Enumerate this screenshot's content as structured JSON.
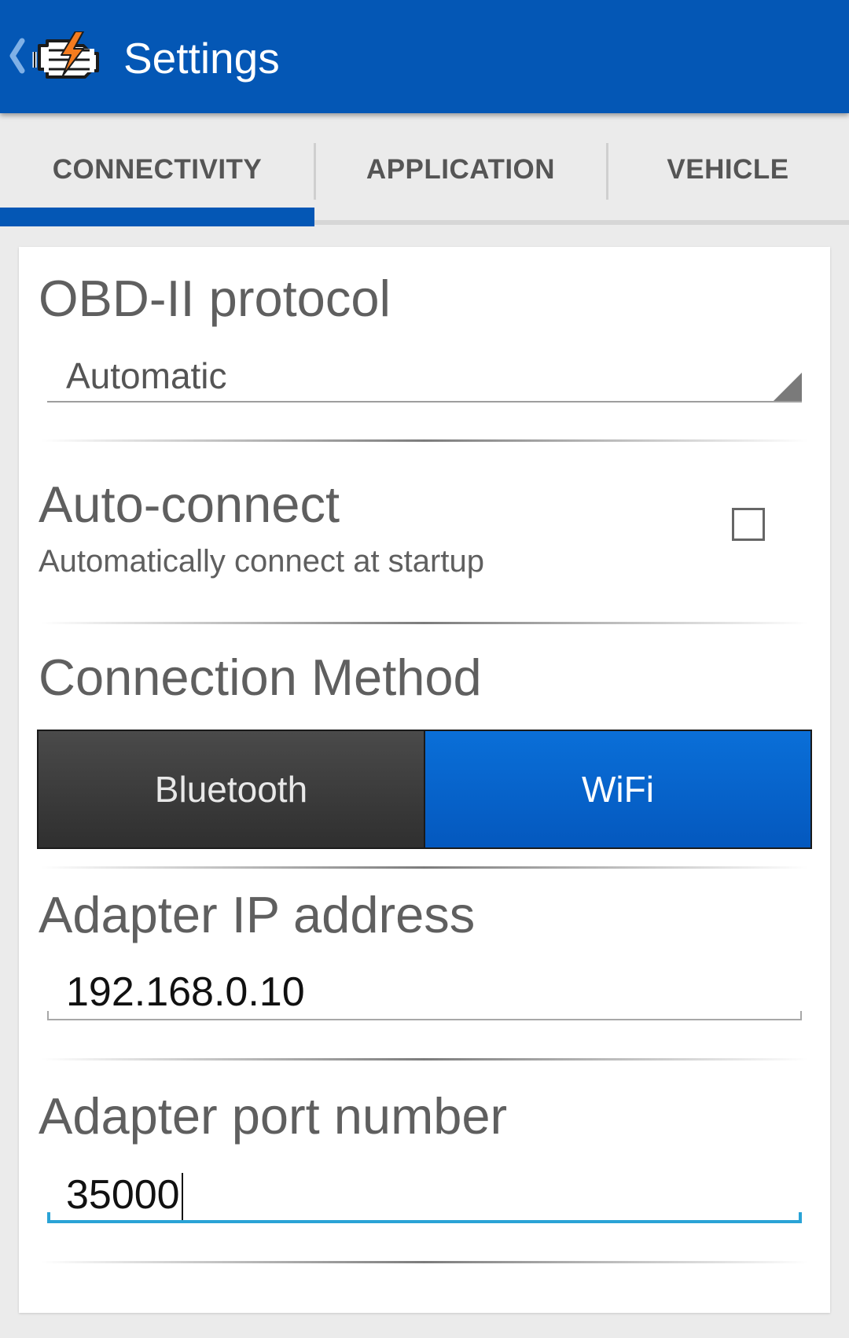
{
  "action_bar": {
    "title": "Settings"
  },
  "tabs": [
    {
      "label": "CONNECTIVITY",
      "selected": true
    },
    {
      "label": "APPLICATION",
      "selected": false
    },
    {
      "label": "VEHICLE",
      "selected": false
    }
  ],
  "obd_protocol": {
    "title": "OBD-II protocol",
    "value": "Automatic"
  },
  "auto_connect": {
    "title": "Auto-connect",
    "summary": "Automatically connect at startup",
    "checked": false
  },
  "connection_method": {
    "title": "Connection Method",
    "options": [
      "Bluetooth",
      "WiFi"
    ],
    "selected": "WiFi"
  },
  "adapter_ip": {
    "title": "Adapter IP address",
    "value": "192.168.0.10"
  },
  "adapter_port": {
    "title": "Adapter port number",
    "value": "35000",
    "focused": true
  },
  "colors": {
    "primary": "#0457b5",
    "segment_selected": "#0a6fd8",
    "focus_underline": "#2aa3d6",
    "logo_accent": "#f57c1f"
  }
}
